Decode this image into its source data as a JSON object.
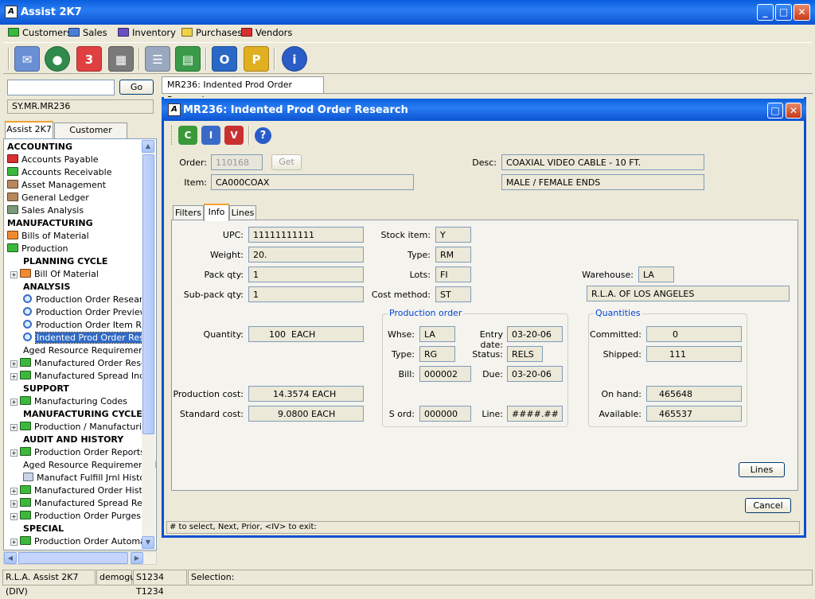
{
  "app": {
    "title": "Assist 2K7",
    "logo": "A"
  },
  "menu": {
    "items": [
      {
        "label": "Customers",
        "color": "#3cb83c"
      },
      {
        "label": "Sales",
        "color": "#4a7fd8"
      },
      {
        "label": "Inventory",
        "color": "#6a4fc4"
      },
      {
        "label": "Purchases",
        "color": "#f0d24a"
      },
      {
        "label": "Vendors",
        "color": "#d83030"
      }
    ]
  },
  "toolbar": {
    "icons": [
      {
        "name": "mail-icon",
        "glyph": "✉",
        "color": "#6b8fd4"
      },
      {
        "name": "globe-icon",
        "glyph": "●",
        "color": "#2f8a4c"
      },
      {
        "name": "calendar-icon",
        "glyph": "3",
        "color": "#e04040"
      },
      {
        "name": "calculator-icon",
        "glyph": "▦",
        "color": "#7a7a7a"
      },
      {
        "name": "form-icon",
        "glyph": "☰",
        "color": "#9aa8c0"
      },
      {
        "name": "report-icon",
        "glyph": "▤",
        "color": "#3a9a4a"
      },
      {
        "name": "outlook-icon",
        "glyph": "O",
        "color": "#2a68c8"
      },
      {
        "name": "notes-icon",
        "glyph": "P",
        "color": "#e0b020"
      },
      {
        "name": "info-icon",
        "glyph": "i",
        "color": "#2a5cc8"
      }
    ]
  },
  "search": {
    "value": "",
    "go_label": "Go",
    "path": "SY.MR.MR236"
  },
  "left_tabs": [
    "Assist 2K7",
    "Customer Service"
  ],
  "tree": [
    {
      "label": "ACCOUNTING",
      "type": "h",
      "indent": 0
    },
    {
      "label": "Accounts Payable",
      "type": "folder",
      "color": "#d83030",
      "indent": 0
    },
    {
      "label": "Accounts Receivable",
      "type": "folder",
      "color": "#3cb83c",
      "indent": 0
    },
    {
      "label": "Asset Management",
      "type": "folder",
      "color": "#b8885a",
      "indent": 0
    },
    {
      "label": "General Ledger",
      "type": "folder",
      "color": "#b8885a",
      "indent": 0
    },
    {
      "label": "Sales Analysis",
      "type": "folder",
      "color": "#7a9a7a",
      "indent": 0
    },
    {
      "label": "MANUFACTURING",
      "type": "h",
      "indent": 0
    },
    {
      "label": "Bills of Material",
      "type": "folder",
      "color": "#f08a30",
      "indent": 0
    },
    {
      "label": "Production",
      "type": "folder",
      "color": "#3cb83c",
      "indent": 0
    },
    {
      "label": "PLANNING CYCLE",
      "type": "h",
      "indent": 20
    },
    {
      "label": "Bill Of Material",
      "type": "folder",
      "color": "#f08a30",
      "indent": 20,
      "exp": true
    },
    {
      "label": "ANALYSIS",
      "type": "h",
      "indent": 20
    },
    {
      "label": "Production Order Research",
      "type": "mag",
      "indent": 20
    },
    {
      "label": "Production Order Preview",
      "type": "mag",
      "indent": 20
    },
    {
      "label": "Production Order Item Res",
      "type": "mag",
      "indent": 20
    },
    {
      "label": "Indented Prod Order Rese",
      "type": "mag",
      "indent": 20,
      "selected": true
    },
    {
      "label": "Aged Resource Requirements",
      "type": "plain",
      "indent": 20
    },
    {
      "label": "Manufactured Order Resea",
      "type": "folder",
      "color": "#3cb83c",
      "indent": 20,
      "exp": true
    },
    {
      "label": "Manufactured Spread Inqu",
      "type": "folder",
      "color": "#3cb83c",
      "indent": 20,
      "exp": true
    },
    {
      "label": "SUPPORT",
      "type": "h",
      "indent": 20
    },
    {
      "label": "Manufacturing Codes",
      "type": "folder",
      "color": "#3cb83c",
      "indent": 20,
      "exp": true
    },
    {
      "label": "MANUFACTURING CYCLE",
      "type": "h",
      "indent": 20
    },
    {
      "label": "Production / Manufacturing",
      "type": "folder",
      "color": "#3cb83c",
      "indent": 20,
      "exp": true
    },
    {
      "label": "AUDIT AND HISTORY",
      "type": "h",
      "indent": 20
    },
    {
      "label": "Production Order Reports",
      "type": "folder",
      "color": "#3cb83c",
      "indent": 20,
      "exp": true
    },
    {
      "label": "Aged Resource Requirements R",
      "type": "plain",
      "indent": 20
    },
    {
      "label": "Manufact Fulfill Jrnl History",
      "type": "print",
      "indent": 20
    },
    {
      "label": "Manufactured Order Hist R",
      "type": "folder",
      "color": "#3cb83c",
      "indent": 20,
      "exp": true
    },
    {
      "label": "Manufactured Spread Repo",
      "type": "folder",
      "color": "#3cb83c",
      "indent": 20,
      "exp": true
    },
    {
      "label": "Production Order Purges",
      "type": "folder",
      "color": "#3cb83c",
      "indent": 20,
      "exp": true
    },
    {
      "label": "SPECIAL",
      "type": "h",
      "indent": 20
    },
    {
      "label": "Production Order Automati",
      "type": "folder",
      "color": "#3cb83c",
      "indent": 20,
      "exp": true
    }
  ],
  "doc_tab": "MR236: Indented Prod Order Research",
  "window": {
    "title": "MR236: Indented Prod Order Research"
  },
  "header": {
    "order_label": "Order:",
    "order": "110168",
    "get": "Get",
    "item_label": "Item:",
    "item": "CA000COAX",
    "desc_label": "Desc:",
    "desc1": "COAXIAL VIDEO CABLE - 10 FT.",
    "desc2": "MALE / FEMALE ENDS"
  },
  "tabs": [
    "Filters",
    "Info",
    "Lines"
  ],
  "info": {
    "upc_label": "UPC:",
    "upc": "11111111111",
    "weight_label": "Weight:",
    "weight": "20.",
    "packqty_label": "Pack qty:",
    "packqty": "1",
    "subpack_label": "Sub-pack qty:",
    "subpack": "1",
    "quantity_label": "Quantity:",
    "quantity": "100  EACH",
    "prodcost_label": "Production cost:",
    "prodcost": "14.3574 EACH",
    "stdcost_label": "Standard cost:",
    "stdcost": "9.0800 EACH",
    "stockitem_label": "Stock item:",
    "stockitem": "Y",
    "type_label": "Type:",
    "type": "RM",
    "lots_label": "Lots:",
    "lots": "FI",
    "costmethod_label": "Cost method:",
    "costmethod": "ST",
    "warehouse_label": "Warehouse:",
    "warehouse": "LA",
    "warehouse_name": "R.L.A. OF LOS ANGELES"
  },
  "prod_order": {
    "title": "Production order",
    "whse_label": "Whse:",
    "whse": "LA",
    "entry_label": "Entry date:",
    "entry": "03-20-06",
    "type_label": "Type:",
    "type": "RG",
    "status_label": "Status:",
    "status": "RELS",
    "bill_label": "Bill:",
    "bill": "000002",
    "due_label": "Due:",
    "due": "03-20-06",
    "sord_label": "S ord:",
    "sord": "000000",
    "line_label": "Line:",
    "line": "####.##"
  },
  "quantities": {
    "title": "Quantities",
    "committed_label": "Committed:",
    "committed": "0",
    "shipped_label": "Shipped:",
    "shipped": "111",
    "onhand_label": "On hand:",
    "onhand": "465648",
    "available_label": "Available:",
    "available": "465537"
  },
  "buttons": {
    "lines": "Lines",
    "cancel": "Cancel"
  },
  "hint": "# to select,  Next,  Prior,  <IV> to exit:",
  "statusbar": [
    "R.L.A. Assist 2K7 (DIV)",
    "demogui",
    "S1234 T1234",
    "Selection:"
  ]
}
